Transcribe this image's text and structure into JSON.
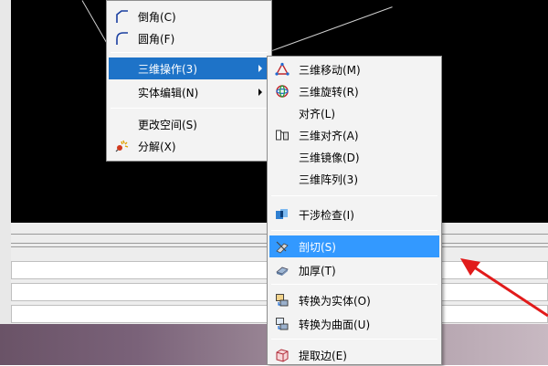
{
  "menu_left": {
    "items": [
      {
        "label": "倒角(C)"
      },
      {
        "label": "圆角(F)"
      },
      {
        "label": "三维操作(3)"
      },
      {
        "label": "实体编辑(N)"
      },
      {
        "label": "更改空间(S)"
      },
      {
        "label": "分解(X)"
      }
    ]
  },
  "menu_3d": {
    "items": [
      {
        "label": "三维移动(M)"
      },
      {
        "label": "三维旋转(R)"
      },
      {
        "label": "对齐(L)"
      },
      {
        "label": "三维对齐(A)"
      },
      {
        "label": "三维镜像(D)"
      },
      {
        "label": "三维阵列(3)"
      },
      {
        "label": "干涉检查(I)"
      },
      {
        "label": "剖切(S)"
      },
      {
        "label": "加厚(T)"
      },
      {
        "label": "转换为实体(O)"
      },
      {
        "label": "转换为曲面(U)"
      },
      {
        "label": "提取边(E)"
      }
    ]
  },
  "colors": {
    "viewport_bg": "#000000",
    "menu_bg": "#f3f3f3",
    "highlight": "#3399ff",
    "highlight_dark": "#1e73c8",
    "annotation_arrow": "#e11b1b"
  },
  "icons": {
    "chamfer": "chamfer-icon",
    "fillet": "fillet-icon",
    "explode": "explode-icon",
    "move3d": "3d-move-icon",
    "rotate3d": "3d-rotate-icon",
    "align3d": "3d-align-icon",
    "interference": "interference-check-icon",
    "slice": "slice-icon",
    "thicken": "thicken-icon",
    "convert_solid": "convert-to-solid-icon",
    "convert_surface": "convert-to-surface-icon",
    "extract_edges": "extract-edges-icon"
  }
}
